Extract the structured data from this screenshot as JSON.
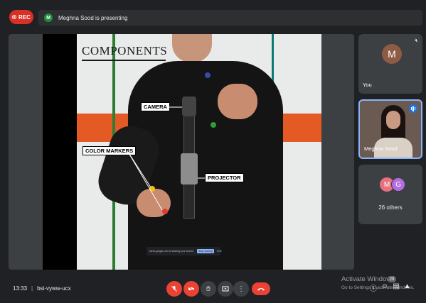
{
  "top_bar": {
    "rec_label": "REC",
    "presenter_initial": "M",
    "presenting_text": "Meghna Sood is presenting"
  },
  "slide": {
    "title": "COMPONENTS",
    "callouts": {
      "camera": "CAMERA",
      "color_markers": "COLOR MARKERS",
      "projector": "PROJECTOR"
    },
    "share_bar": {
      "text": "Meet.google.com is sharing your screen.",
      "stop_label": "Stop sharing",
      "hide_label": "Hide"
    }
  },
  "participants": {
    "you": {
      "initial": "M",
      "label": "You",
      "mic_icon": "mic-off-icon"
    },
    "meghna": {
      "label": "Meghna Sood"
    },
    "others": {
      "initials": [
        "M",
        "G"
      ],
      "label": "26 others"
    }
  },
  "bottom_bar": {
    "time": "13:33",
    "separator": "|",
    "meeting_code": "bsi-vyww-ucx",
    "participant_count": "29",
    "controls": [
      "mic-off-icon",
      "camera-off-icon",
      "raise-hand-icon",
      "present-icon",
      "more-options-icon",
      "end-call-icon"
    ]
  },
  "watermark": {
    "title": "Activate Windows",
    "subtitle": "Go to Settings to activate Windows."
  },
  "colors": {
    "background": "#202124",
    "end_call": "#ea4335",
    "accent_blue": "#8ab4f8",
    "rec_red": "#d93025"
  }
}
